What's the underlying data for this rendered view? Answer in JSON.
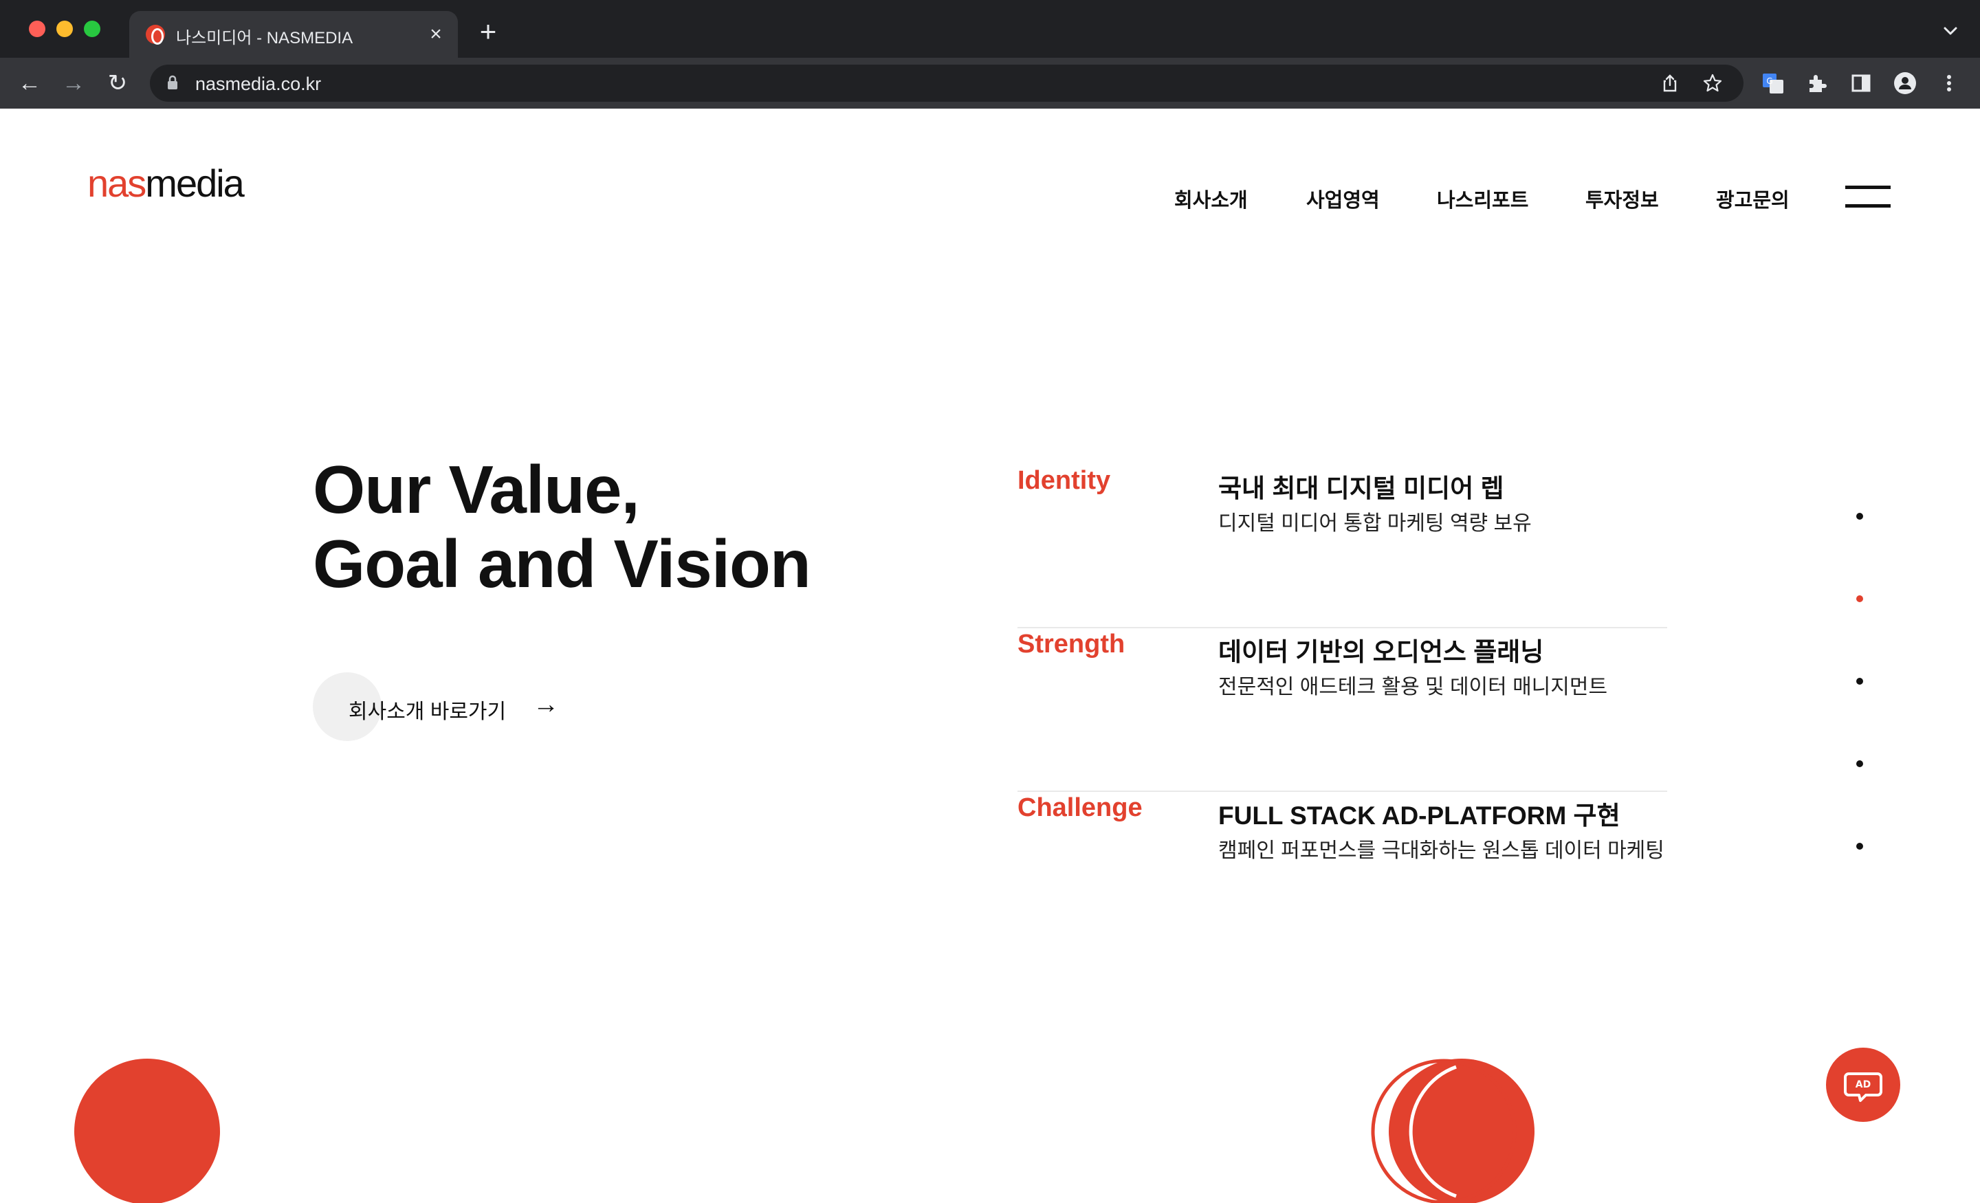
{
  "browser": {
    "tab_title": "나스미디어 - NASMEDIA",
    "tab_close_glyph": "×",
    "new_tab_glyph": "+",
    "url": "nasmedia.co.kr",
    "back_glyph": "←",
    "forward_glyph": "→",
    "reload_glyph": "↻",
    "colors": {
      "frame": "#202124",
      "toolbar": "#35363a",
      "text": "#e8eaed"
    }
  },
  "site": {
    "logo": {
      "part1": "nas",
      "part2": "media"
    },
    "nav": {
      "items": [
        "회사소개",
        "사업영역",
        "나스리포트",
        "투자정보",
        "광고문의"
      ]
    },
    "headline": {
      "line1": "Our Value,",
      "line2": "Goal and Vision"
    },
    "cta": {
      "label": "회사소개 바로가기",
      "arrow": "→"
    },
    "values": [
      {
        "key": "Identity",
        "title": "국내 최대 디지털 미디어 렙",
        "desc": "디지털 미디어 통합 마케팅 역량 보유"
      },
      {
        "key": "Strength",
        "title": "데이터 기반의 오디언스 플래닝",
        "desc": "전문적인 애드테크 활용 및 데이터 매니지먼트"
      },
      {
        "key": "Challenge",
        "title": "FULL STACK AD-PLATFORM 구현",
        "desc": "캠페인 퍼포먼스를 극대화하는 원스톱 데이터 마케팅"
      }
    ],
    "ad_button": {
      "label": "AD"
    },
    "colors": {
      "accent": "#e2412e",
      "text": "#111111",
      "divider": "#e9e9e9"
    }
  }
}
